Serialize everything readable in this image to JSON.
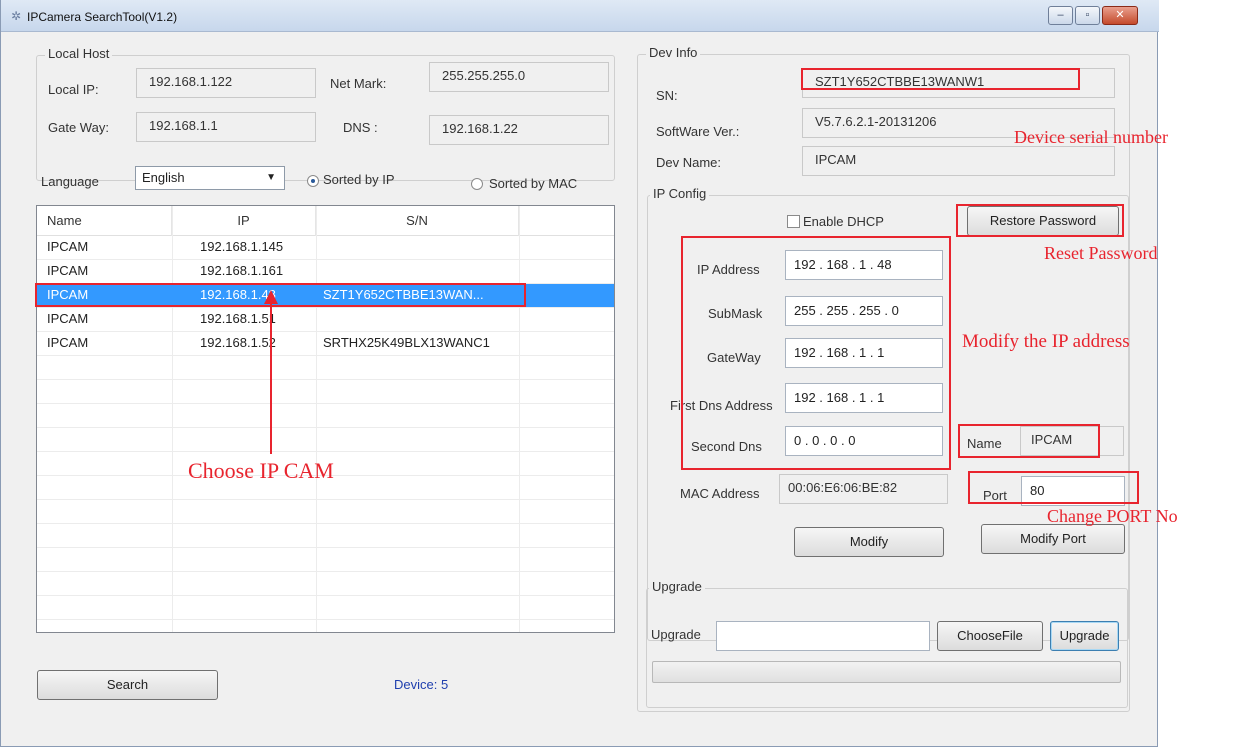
{
  "window": {
    "title": "IPCamera SearchTool(V1.2)",
    "controls": {
      "minimize": "–",
      "maximize": "▫",
      "close": "✕"
    }
  },
  "local_host": {
    "group_label": "Local Host",
    "local_ip_label": "Local IP:",
    "local_ip": "192.168.1.122",
    "net_mark_label": "Net Mark:",
    "net_mark": "255.255.255.0",
    "gateway_label": "Gate Way:",
    "gateway": "192.168.1.1",
    "dns_label": "DNS :",
    "dns": "192.168.1.22"
  },
  "filters": {
    "language_label": "Language",
    "language_value": "English",
    "sorted_by_ip": "Sorted by IP",
    "sorted_by_mac": "Sorted by MAC",
    "sorted_by_ip_selected": true
  },
  "device_list": {
    "columns": [
      "Name",
      "IP",
      "S/N"
    ],
    "rows": [
      {
        "name": "IPCAM",
        "ip": "192.168.1.145",
        "sn": ""
      },
      {
        "name": "IPCAM",
        "ip": "192.168.1.161",
        "sn": ""
      },
      {
        "name": "IPCAM",
        "ip": "192.168.1.48",
        "sn": "SZT1Y652CTBBE13WAN..."
      },
      {
        "name": "IPCAM",
        "ip": "192.168.1.51",
        "sn": ""
      },
      {
        "name": "IPCAM",
        "ip": "192.168.1.52",
        "sn": "SRTHX25K49BLX13WANC1"
      }
    ],
    "selected_index": 2
  },
  "search_button": "Search",
  "device_count": "Device: 5",
  "dev_info": {
    "group_label": "Dev Info",
    "sn_label": "SN:",
    "sn": "SZT1Y652CTBBE13WANW1",
    "software_label": "SoftWare Ver.:",
    "software": "V5.7.6.2.1-20131206",
    "dev_name_label": "Dev Name:",
    "dev_name": "IPCAM"
  },
  "ip_config": {
    "group_label": "IP Config",
    "enable_dhcp": "Enable DHCP",
    "restore_password": "Restore Password",
    "ip_address_label": "IP Address",
    "ip_address": "192 . 168 .  1  .  48",
    "submask_label": "SubMask",
    "submask": "255 . 255 . 255 .  0",
    "gateway_label": "GateWay",
    "gateway": "192 . 168 .  1  .  1",
    "first_dns_label": "First Dns Address",
    "first_dns": "192 . 168 .  1  .  1",
    "second_dns_label": "Second Dns",
    "second_dns": " 0  .  0  .  0  .  0",
    "name_label": "Name",
    "name": "IPCAM",
    "mac_label": "MAC Address",
    "mac": "00:06:E6:06:BE:82",
    "port_label": "Port",
    "port": "80",
    "modify_button": "Modify",
    "modify_port_button": "Modify Port"
  },
  "upgrade": {
    "group_label": "Upgrade",
    "upgrade_label": "Upgrade",
    "file_path": "",
    "choose_file_button": "ChooseFile",
    "upgrade_button": "Upgrade",
    "progress": 0
  },
  "annotations": {
    "device_serial_number": "Device serial number",
    "reset_password": "Reset Password",
    "modify_ip": "Modify  the IP address",
    "choose_ip_cam": "Choose IP CAM",
    "change_port": "Change PORT No",
    "color": "#e8242e"
  }
}
